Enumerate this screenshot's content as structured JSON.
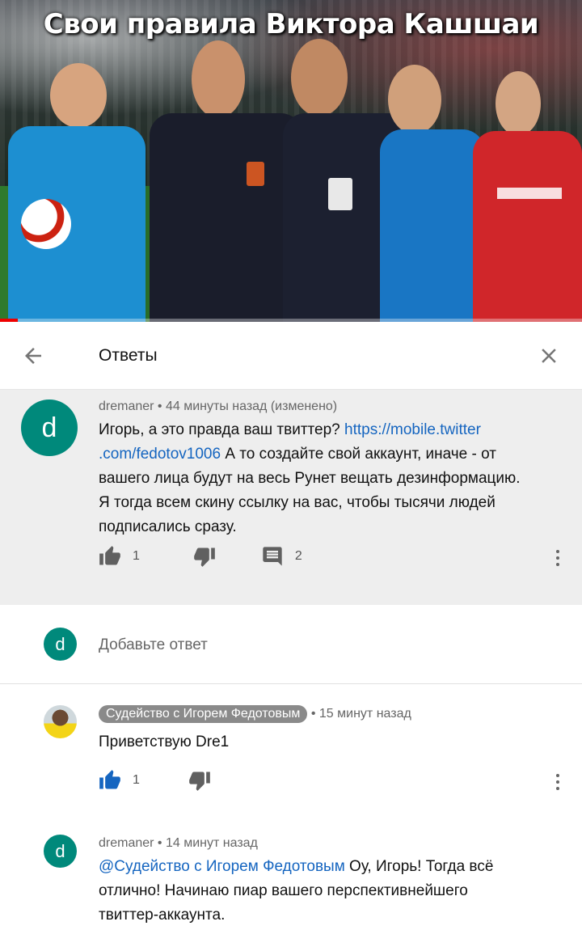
{
  "video": {
    "title": "Свои правила Виктора Кашшаи",
    "progress_fraction": 0.03
  },
  "header": {
    "title": "Ответы"
  },
  "main_comment": {
    "avatar_letter": "d",
    "author": "dremaner",
    "time": " • 44 минуты назад (изменено)",
    "text_before_link": "Игорь, а это правда ваш твиттер? ",
    "link_line1": "https://mobile.twitter",
    "link_line2": ".com/fedotov1006",
    "text_after_link_line1": " А то создайте свой аккаунт, иначе - от",
    "text_line3": "вашего лица будут на весь Рунет вещать дезинформацию.",
    "text_line4": "Я тогда всем скину ссылку на вас, чтобы тысячи людей",
    "text_line5": "подписались сразу.",
    "likes": "1",
    "replies": "2"
  },
  "add_reply": {
    "avatar_letter": "d",
    "placeholder": "Добавьте ответ"
  },
  "replies": [
    {
      "author": "Судейство с Игорем Федотовым",
      "time": " • 15 минут назад",
      "text": "Приветствую Dre1",
      "likes": "1"
    },
    {
      "avatar_letter": "d",
      "author": "dremaner",
      "time": " • 14 минут назад",
      "mention": "@Судейство с Игорем Федотовым",
      "text_line1": " Оу, Игорь! Тогда всё",
      "text_line2": "отлично! Начинаю пиар вашего перспективнейшего",
      "text_line3": "твиттер-аккаунта."
    }
  ],
  "colors": {
    "avatar_green": "#00897b",
    "link_blue": "#1565c0",
    "like_active_blue": "#1565c0",
    "progress_red": "#e00000"
  }
}
